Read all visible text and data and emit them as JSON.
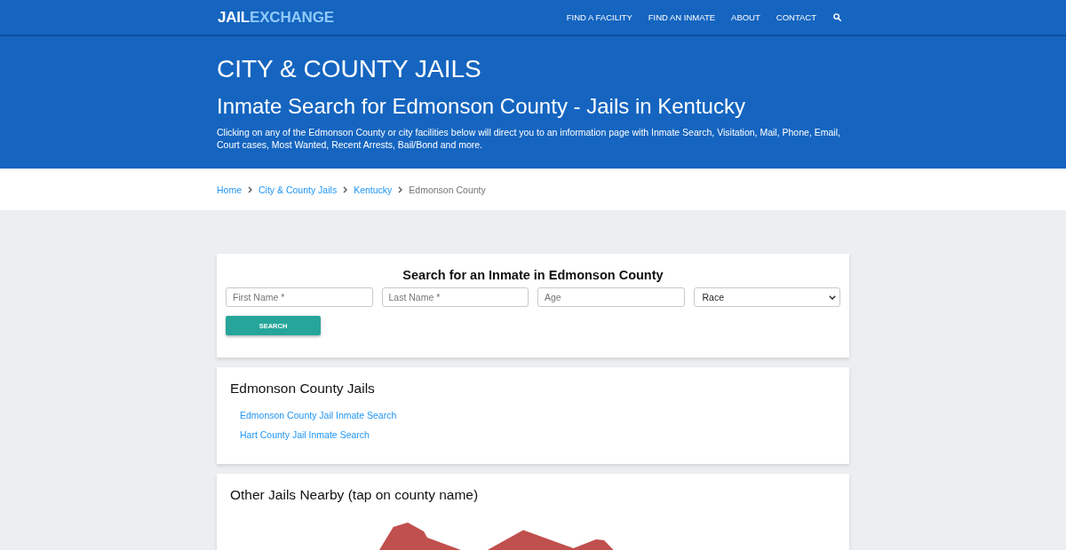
{
  "header": {
    "logo": {
      "primary": "JAIL",
      "secondary": "EXCHANGE"
    },
    "nav": [
      "FIND A FACILITY",
      "FIND AN INMATE",
      "ABOUT",
      "CONTACT"
    ]
  },
  "hero": {
    "category": "CITY & COUNTY JAILS",
    "title": "Inmate Search for Edmonson County - Jails in Kentucky",
    "description": "Clicking on any of the Edmonson County or city facilities below will direct you to an information page with Inmate Search, Visitation, Mail, Phone, Email, Court cases, Most Wanted, Recent Arrests, Bail/Bond and more."
  },
  "breadcrumb": [
    {
      "label": "Home",
      "current": false
    },
    {
      "label": "City & County Jails",
      "current": false
    },
    {
      "label": "Kentucky",
      "current": false
    },
    {
      "label": "Edmonson County",
      "current": true
    }
  ],
  "search_form": {
    "title": "Search for an Inmate in Edmonson County",
    "fields": [
      {
        "kind": "text",
        "placeholder": "First Name *"
      },
      {
        "kind": "text",
        "placeholder": "Last Name *"
      },
      {
        "kind": "text",
        "placeholder": "Age"
      },
      {
        "kind": "select",
        "value": "Race"
      }
    ],
    "button": "SEARCH"
  },
  "county_jails": {
    "title": "Edmonson County Jails",
    "links": [
      "Edmonson County Jail Inmate Search",
      "Hart County Jail Inmate Search"
    ]
  },
  "nearby": {
    "title": "Other Jails Nearby (tap on county name)"
  }
}
